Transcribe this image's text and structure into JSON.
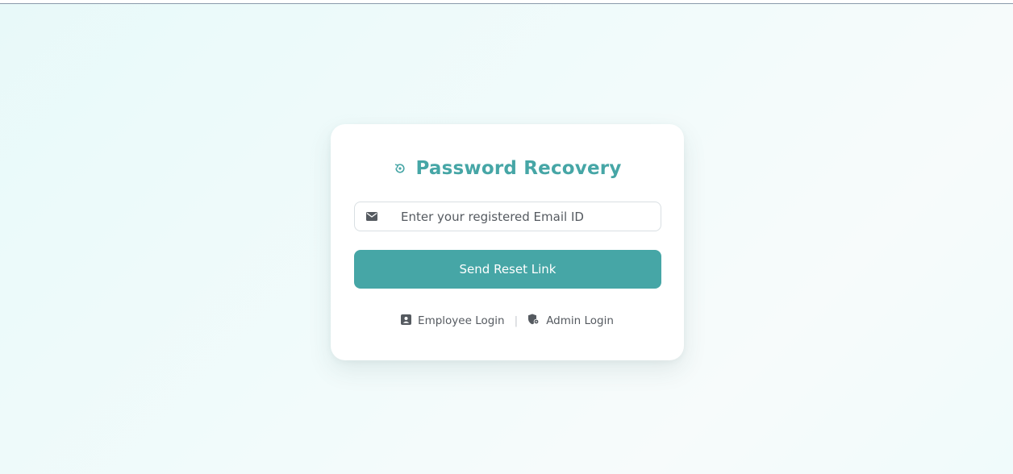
{
  "card": {
    "title": "Password Recovery",
    "title_icon": "restore-icon"
  },
  "form": {
    "email_placeholder": "Enter your registered Email ID",
    "email_value": "",
    "email_icon": "envelope-icon",
    "submit_label": "Send Reset Link"
  },
  "links": {
    "employee_label": "Employee Login",
    "employee_icon": "id-card-icon",
    "separator": "|",
    "admin_label": "Admin Login",
    "admin_icon": "shield-gear-icon"
  },
  "colors": {
    "accent": "#46a6a6",
    "text_muted": "#555a60"
  }
}
